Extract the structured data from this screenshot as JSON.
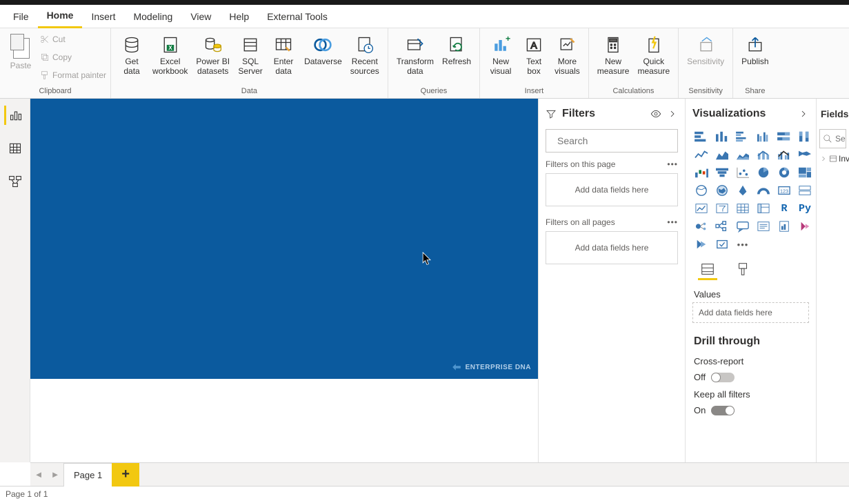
{
  "menubar": {
    "file": "File",
    "home": "Home",
    "insert": "Insert",
    "modeling": "Modeling",
    "view": "View",
    "help": "Help",
    "external_tools": "External Tools"
  },
  "ribbon": {
    "clipboard": {
      "paste": "Paste",
      "cut": "Cut",
      "copy": "Copy",
      "format_painter": "Format painter",
      "group": "Clipboard"
    },
    "data": {
      "get_data": "Get\ndata",
      "excel": "Excel\nworkbook",
      "pbi_datasets": "Power BI\ndatasets",
      "sql": "SQL\nServer",
      "enter": "Enter\ndata",
      "dataverse": "Dataverse",
      "recent": "Recent\nsources",
      "group": "Data"
    },
    "queries": {
      "transform": "Transform\ndata",
      "refresh": "Refresh",
      "group": "Queries"
    },
    "insert": {
      "new_visual": "New\nvisual",
      "text_box": "Text\nbox",
      "more_visuals": "More\nvisuals",
      "group": "Insert"
    },
    "calculations": {
      "new_measure": "New\nmeasure",
      "quick_measure": "Quick\nmeasure",
      "group": "Calculations"
    },
    "sensitivity": {
      "sensitivity": "Sensitivity",
      "group": "Sensitivity"
    },
    "share": {
      "publish": "Publish",
      "group": "Share"
    }
  },
  "canvas": {
    "logo_text": "ENTERPRISE DNA"
  },
  "filters": {
    "title": "Filters",
    "search_placeholder": "Search",
    "page_label": "Filters on this page",
    "all_label": "Filters on all pages",
    "drop_hint": "Add data fields here"
  },
  "viz": {
    "title": "Visualizations",
    "values_label": "Values",
    "values_hint": "Add data fields here",
    "drill_title": "Drill through",
    "cross_report": "Cross-report",
    "cross_report_state": "Off",
    "keep_filters": "Keep all filters",
    "keep_filters_state": "On",
    "letter_r": "R",
    "letter_py": "Py"
  },
  "fields": {
    "title": "Fields",
    "search_placeholder": "Sea",
    "table_name": "Inv"
  },
  "pagetabs": {
    "page1": "Page 1",
    "add": "+"
  },
  "statusbar": {
    "text": "Page 1 of 1"
  }
}
